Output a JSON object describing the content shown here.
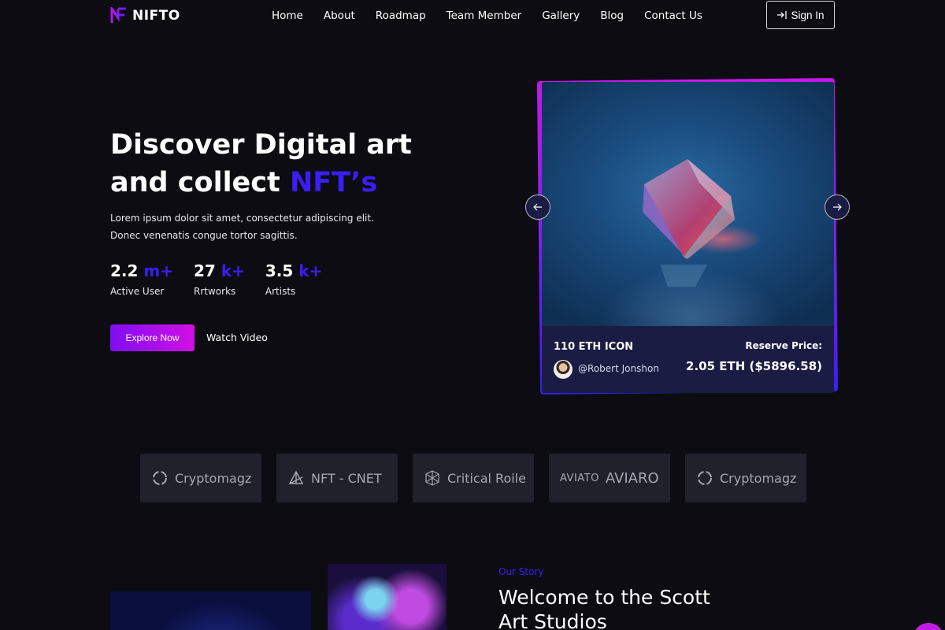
{
  "header": {
    "logo_text": "NIFTO",
    "nav": [
      "Home",
      "About",
      "Roadmap",
      "Team Member",
      "Gallery",
      "Blog",
      "Contact Us"
    ],
    "signin_label": "Sign In"
  },
  "hero": {
    "title_line1": "Discover Digital art",
    "title_line2_prefix": "and collect ",
    "title_line2_accent": "NFT’s",
    "desc_line1": "Lorem ipsum dolor sit amet, consectetur adipiscing elit.",
    "desc_line2": "Donec venenatis congue tortor sagittis.",
    "stats": [
      {
        "value": "2.2",
        "unit": "m+",
        "label": "Active User"
      },
      {
        "value": "27",
        "unit": "k+",
        "label": "Rrtworks"
      },
      {
        "value": "3.5",
        "unit": "k+",
        "label": "Artists"
      }
    ],
    "explore_label": "Explore Now",
    "watch_label": "Watch Video"
  },
  "card": {
    "title": "110 ETH ICON",
    "user": "@Robert Jonshon",
    "reserve_label": "Reserve Price:",
    "reserve_price": "2.05 ETH ($5896.58)"
  },
  "partners": [
    {
      "name": "Cryptomagz",
      "icon": "cryptomagz-logo-icon"
    },
    {
      "name": "NFT - CNET",
      "icon": "nft-cnet-logo-icon"
    },
    {
      "name": "Critical Roile",
      "icon": "critical-roile-logo-icon"
    },
    {
      "name": "AVIARO",
      "icon": "aviato-logo-icon",
      "mark": "AVIATO"
    },
    {
      "name": "Cryptomagz",
      "icon": "cryptomagz-logo-icon"
    }
  ],
  "story": {
    "kicker": "Our Story",
    "title": "Welcome to the Scott Art Studios"
  },
  "colors": {
    "background": "#0d0c12",
    "accent_blue": "#3b1df5",
    "accent_purple": "#7f0ef2",
    "accent_magenta": "#d20fe6",
    "card_panel": "#1b1c43",
    "partner_tile": "#21212b"
  }
}
